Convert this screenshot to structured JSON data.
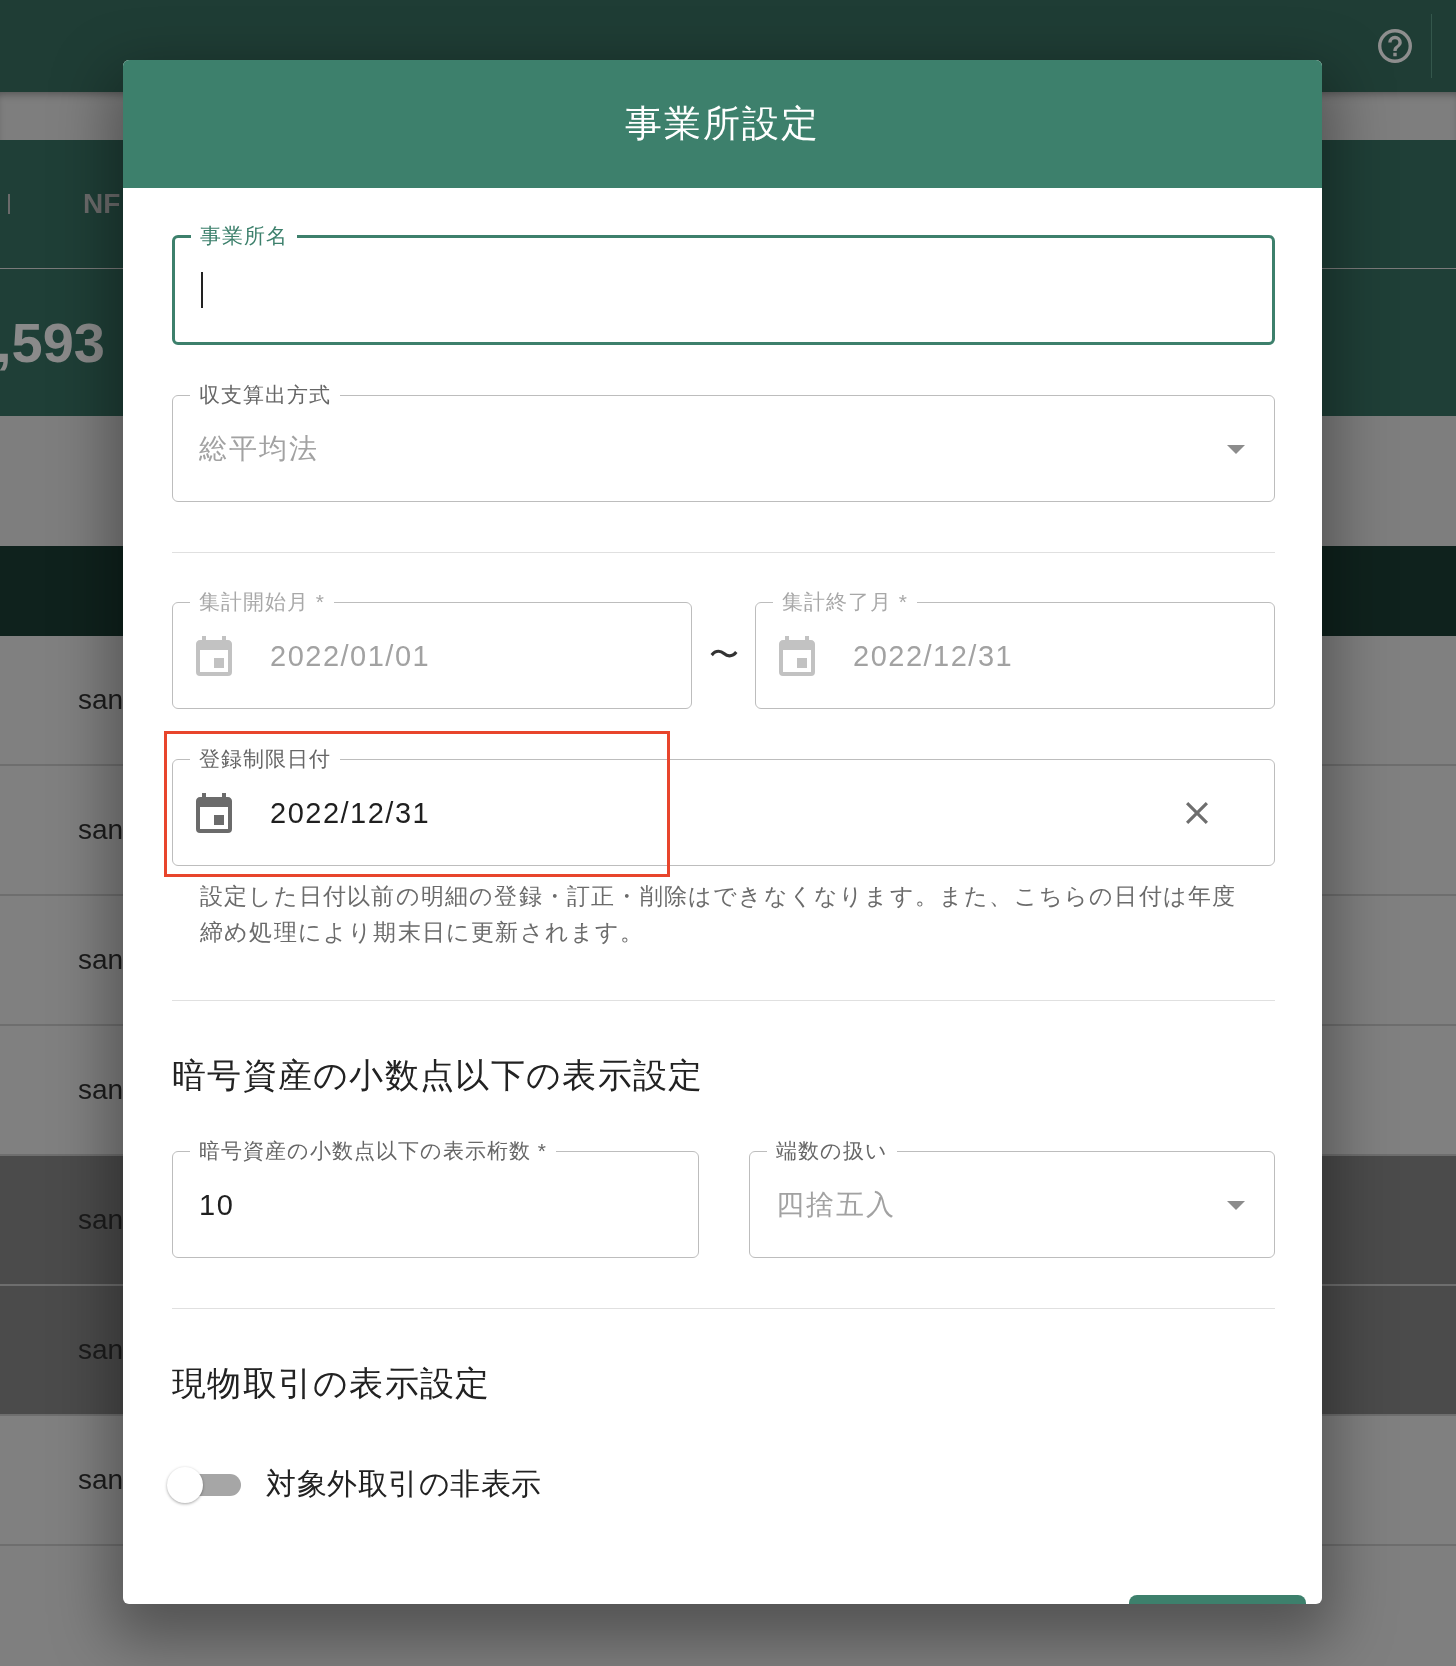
{
  "tab_bar": {
    "tabs": [
      {
        "label": "NF"
      }
    ]
  },
  "summary": {
    "amount": ",593"
  },
  "table": {
    "rows": [
      {
        "cell": "san",
        "highlighted": false
      },
      {
        "cell": "san",
        "highlighted": false
      },
      {
        "cell": "san",
        "highlighted": false
      },
      {
        "cell": "san",
        "highlighted": false
      },
      {
        "cell": "san",
        "highlighted": true
      },
      {
        "cell": "san",
        "highlighted": true
      },
      {
        "cell": "san",
        "highlighted": false
      }
    ]
  },
  "dialog": {
    "title": "事業所設定",
    "groups": [
      {
        "rows": [
          {
            "fields": [
              {
                "kind": "text",
                "label": "事業所名",
                "focused": true,
                "disabled": false,
                "clearable": false,
                "highlighted": false
              }
            ]
          },
          {
            "fields": [
              {
                "kind": "select",
                "label": "収支算出方式",
                "placeholder": "総平均法",
                "focused": false,
                "disabled": false,
                "clearable": false,
                "highlighted": false
              }
            ]
          }
        ]
      },
      {
        "rows": [
          {
            "separator": "〜",
            "fields": [
              {
                "kind": "date",
                "label": "集計開始月 *",
                "value": "2022/01/01",
                "focused": false,
                "disabled": true,
                "clearable": false,
                "highlighted": false
              },
              {
                "kind": "date",
                "label": "集計終了月 *",
                "value": "2022/12/31",
                "focused": false,
                "disabled": true,
                "clearable": false,
                "highlighted": false
              }
            ]
          },
          {
            "fields": [
              {
                "kind": "date",
                "label": "登録制限日付",
                "value": "2022/12/31",
                "focused": false,
                "disabled": false,
                "clearable": true,
                "highlighted": true,
                "helper": "設定した日付以前の明細の登録・訂正・削除はできなくなります。また、こちらの日付は年度締め処理により期末日に更新されます。"
              }
            ]
          }
        ]
      },
      {
        "heading": "暗号資産の小数点以下の表示設定",
        "rows": [
          {
            "fields": [
              {
                "kind": "number",
                "label": "暗号資産の小数点以下の表示桁数 *",
                "value": "10",
                "focused": false,
                "disabled": false,
                "clearable": false,
                "highlighted": false
              },
              {
                "kind": "select",
                "label": "端数の扱い",
                "placeholder": "四捨五入",
                "focused": false,
                "disabled": false,
                "clearable": false,
                "highlighted": false
              }
            ]
          }
        ]
      },
      {
        "heading": "現物取引の表示設定",
        "rows": [
          {
            "fields": [
              {
                "kind": "switch",
                "label": "対象外取引の非表示",
                "on": false
              }
            ]
          }
        ]
      }
    ],
    "actions": [
      {
        "kind": "primary"
      }
    ]
  }
}
